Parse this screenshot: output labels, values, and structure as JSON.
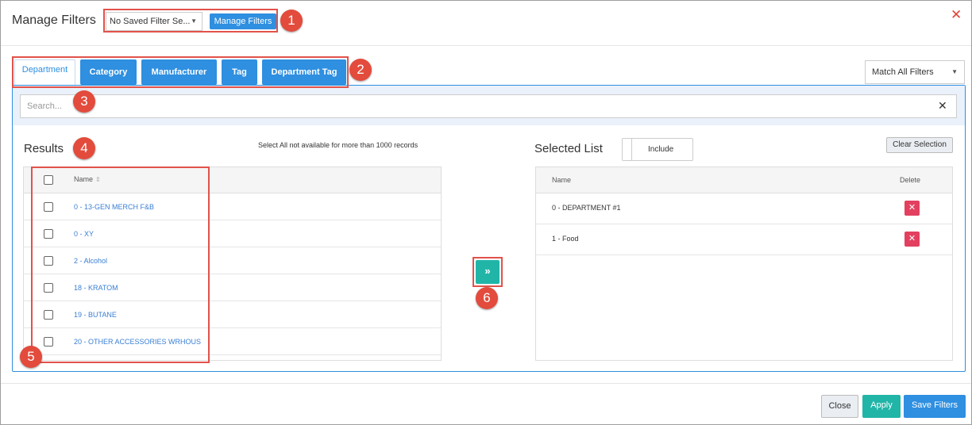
{
  "header": {
    "title": "Manage Filters",
    "saved_filter_select": "No Saved Filter Se...",
    "manage_filters_button": "Manage Filters",
    "close_icon": "close-icon"
  },
  "tabs": [
    {
      "label": "Department",
      "active": true
    },
    {
      "label": "Category",
      "active": false
    },
    {
      "label": "Manufacturer",
      "active": false
    },
    {
      "label": "Tag",
      "active": false
    },
    {
      "label": "Department Tag",
      "active": false
    }
  ],
  "match_select": "Match All Filters",
  "search": {
    "placeholder": "Search...",
    "clear_icon": "clear-icon"
  },
  "results": {
    "title": "Results",
    "note": "Select All not available for more than 1000 records",
    "column_name": "Name",
    "rows": [
      "0 - 13-GEN MERCH F&B",
      "0 - XY",
      "2 - Alcohol",
      "18 - KRATOM",
      "19 - BUTANE",
      "20 - OTHER ACCESSORIES WRHOUS"
    ]
  },
  "move_button_icon": "double-chevron-right-icon",
  "selected": {
    "title": "Selected List",
    "toggle_label": "Include",
    "clear_button": "Clear Selection",
    "column_name": "Name",
    "column_delete": "Delete",
    "rows": [
      "0 - DEPARTMENT #1",
      "1 - Food"
    ]
  },
  "annotations": [
    "1",
    "2",
    "3",
    "4",
    "5",
    "6"
  ],
  "footer": {
    "close": "Close",
    "apply": "Apply",
    "save": "Save Filters"
  },
  "colors": {
    "primary": "#2f8fe0",
    "teal": "#21b5a8",
    "danger": "#e34060",
    "annotation": "#e34b3c"
  }
}
